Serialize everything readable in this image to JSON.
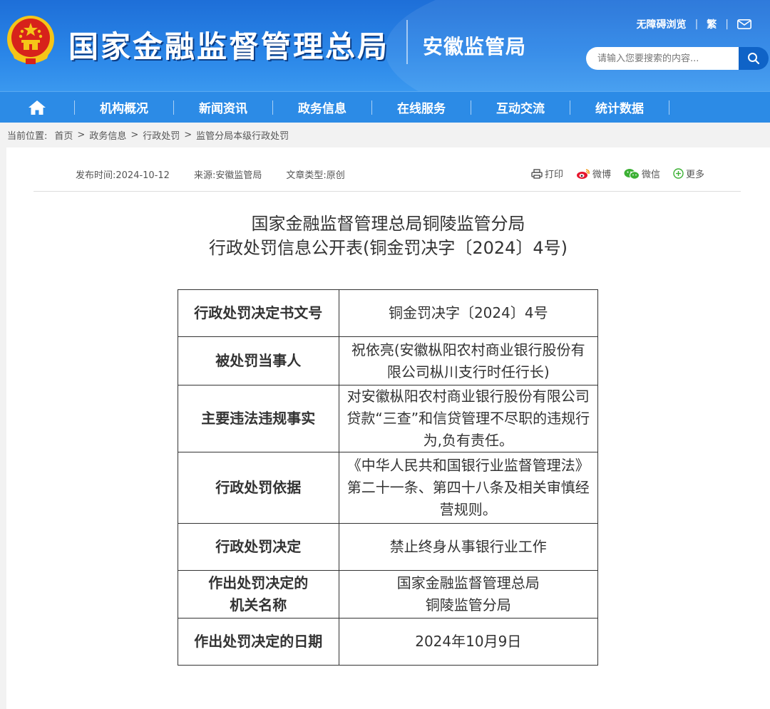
{
  "header": {
    "site_title": "国家金融监督管理总局",
    "sub_title": "安徽监管局",
    "accessibility_link": "无障碍浏览",
    "traditional_link": "繁",
    "search_placeholder": "请输入您要搜索的内容..."
  },
  "nav": {
    "items": [
      "机构概况",
      "新闻资讯",
      "政务信息",
      "在线服务",
      "互动交流",
      "统计数据"
    ]
  },
  "breadcrumb": {
    "label": "当前位置:",
    "items": [
      "首页",
      "政务信息",
      "行政处罚",
      "监管分局本级行政处罚"
    ],
    "separator": ">"
  },
  "meta": {
    "publish_time": "发布时间:2024-10-12",
    "source": "来源:安徽监管局",
    "article_type": "文章类型:原创"
  },
  "share": {
    "print": "打印",
    "weibo": "微博",
    "wechat": "微信",
    "more": "更多"
  },
  "document": {
    "title_line1": "国家金融监督管理总局铜陵监管分局",
    "title_line2": "行政处罚信息公开表(铜金罚决字〔2024〕4号)"
  },
  "table": {
    "rows": [
      {
        "label": "行政处罚决定书文号",
        "value": "铜金罚决字〔2024〕4号"
      },
      {
        "label": "被处罚当事人",
        "value": "祝依亮(安徽枞阳农村商业银行股份有限公司枞川支行时任行长)"
      },
      {
        "label": "主要违法违规事实",
        "value": "对安徽枞阳农村商业银行股份有限公司贷款“三查”和信贷管理不尽职的违规行为,负有责任。"
      },
      {
        "label": "行政处罚依据",
        "value": "《中华人民共和国银行业监督管理法》第二十一条、第四十八条及相关审慎经营规则。"
      },
      {
        "label": "行政处罚决定",
        "value": "禁止终身从事银行业工作"
      },
      {
        "label_line1": "作出处罚决定的",
        "label_line2": "机关名称",
        "value_line1": "国家金融监督管理总局",
        "value_line2": "铜陵监管分局"
      },
      {
        "label": "作出处罚决定的日期",
        "value": "2024年10月9日"
      }
    ]
  },
  "colors": {
    "header_blue": "#1e6fd8",
    "nav_blue": "#2c8be6",
    "search_button": "#0f63c7",
    "emblem_red": "#d7221b",
    "emblem_gold": "#f5c518"
  }
}
